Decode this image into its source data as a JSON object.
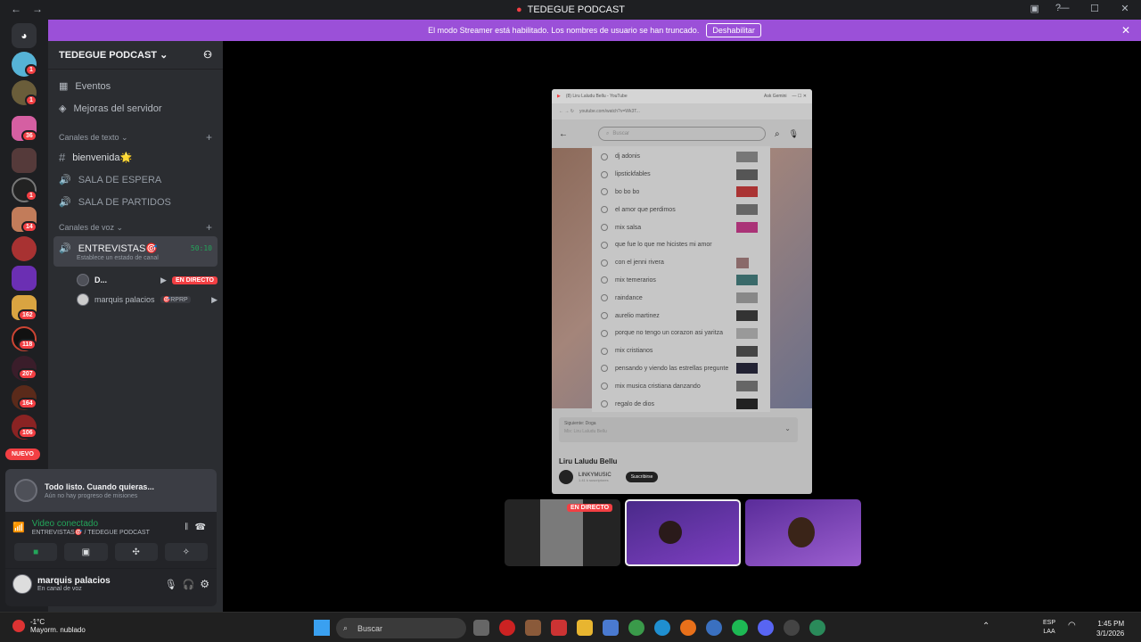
{
  "window": {
    "title": "TEDEGUE PODCAST"
  },
  "banner": {
    "message": "El modo Streamer está habilitado. Los nombres de usuario se han truncado.",
    "disable_label": "Deshabilitar"
  },
  "rail": {
    "badges": [
      "1",
      "1",
      "36",
      "1",
      "14",
      "162",
      "118",
      "207",
      "164",
      "106"
    ],
    "new_label": "NUEVO"
  },
  "server": {
    "name": "TEDEGUE PODCAST"
  },
  "menu": {
    "events": "Eventos",
    "boosts": "Mejoras del servidor"
  },
  "text_channels": {
    "header": "Canales de texto",
    "items": [
      "bienvenida🌟",
      "SALA DE ESPERA",
      "SALA DE PARTIDOS"
    ]
  },
  "voice_channels": {
    "header": "Canales de voz",
    "active": {
      "name": "ENTREVISTAS🎯",
      "time": "50:10",
      "status": "Establece un estado de canal"
    }
  },
  "voice_users": [
    {
      "name": "D...",
      "badge": "EN DIRECTO"
    },
    {
      "name": "marquis palacios",
      "tag": "🎯RPRP"
    }
  ],
  "notice": {
    "title": "Todo listo. Cuando quieras...",
    "sub": "Aún no hay progreso de misiones"
  },
  "connection": {
    "status": "Video conectado",
    "channel": "ENTREVISTAS🎯 / TEDEGUE PODCAST"
  },
  "user": {
    "name": "marquis palacios",
    "status": "En canal de voz"
  },
  "stream": {
    "tab_title": "(8) Liru Laludu Bellu - YouTube",
    "ask": "Ask Gemini",
    "url": "youtube.com/watch?v=Wk3T...",
    "search_placeholder": "Buscar",
    "suggestions": [
      "dj adonis",
      "lipstickfables",
      "bo bo bo",
      "el amor que perdimos",
      "mix salsa",
      "que fue lo que me hicistes mi amor",
      "con el jenni rivera",
      "mix temerarios",
      "raindance",
      "aurelio martinez",
      "porque no tengo un corazon asi yaritza",
      "mix cristianos",
      "pensando y viendo las estrellas pregunte",
      "mix musica cristiana danzando",
      "regalo de dios"
    ],
    "next_label": "Siguiente: Doga",
    "next_sub": "Mix: Liru Laludu Bellu",
    "video_title": "Liru Laludu Bellu",
    "channel": "LINKYMUSIC",
    "subs": "1.41 k suscriptores",
    "subscribe": "Suscribirse"
  },
  "thumb_live": "EN DIRECTO",
  "taskbar": {
    "temp": "-1°C",
    "weather": "Mayorm. nublado",
    "search": "Buscar",
    "lang1": "ESP",
    "lang2": "LAA",
    "time": "1:45 PM",
    "date": "3/1/2026"
  },
  "colors": {
    "accent": "#9b50d8",
    "live": "#f23f43",
    "connected": "#23a55a"
  }
}
